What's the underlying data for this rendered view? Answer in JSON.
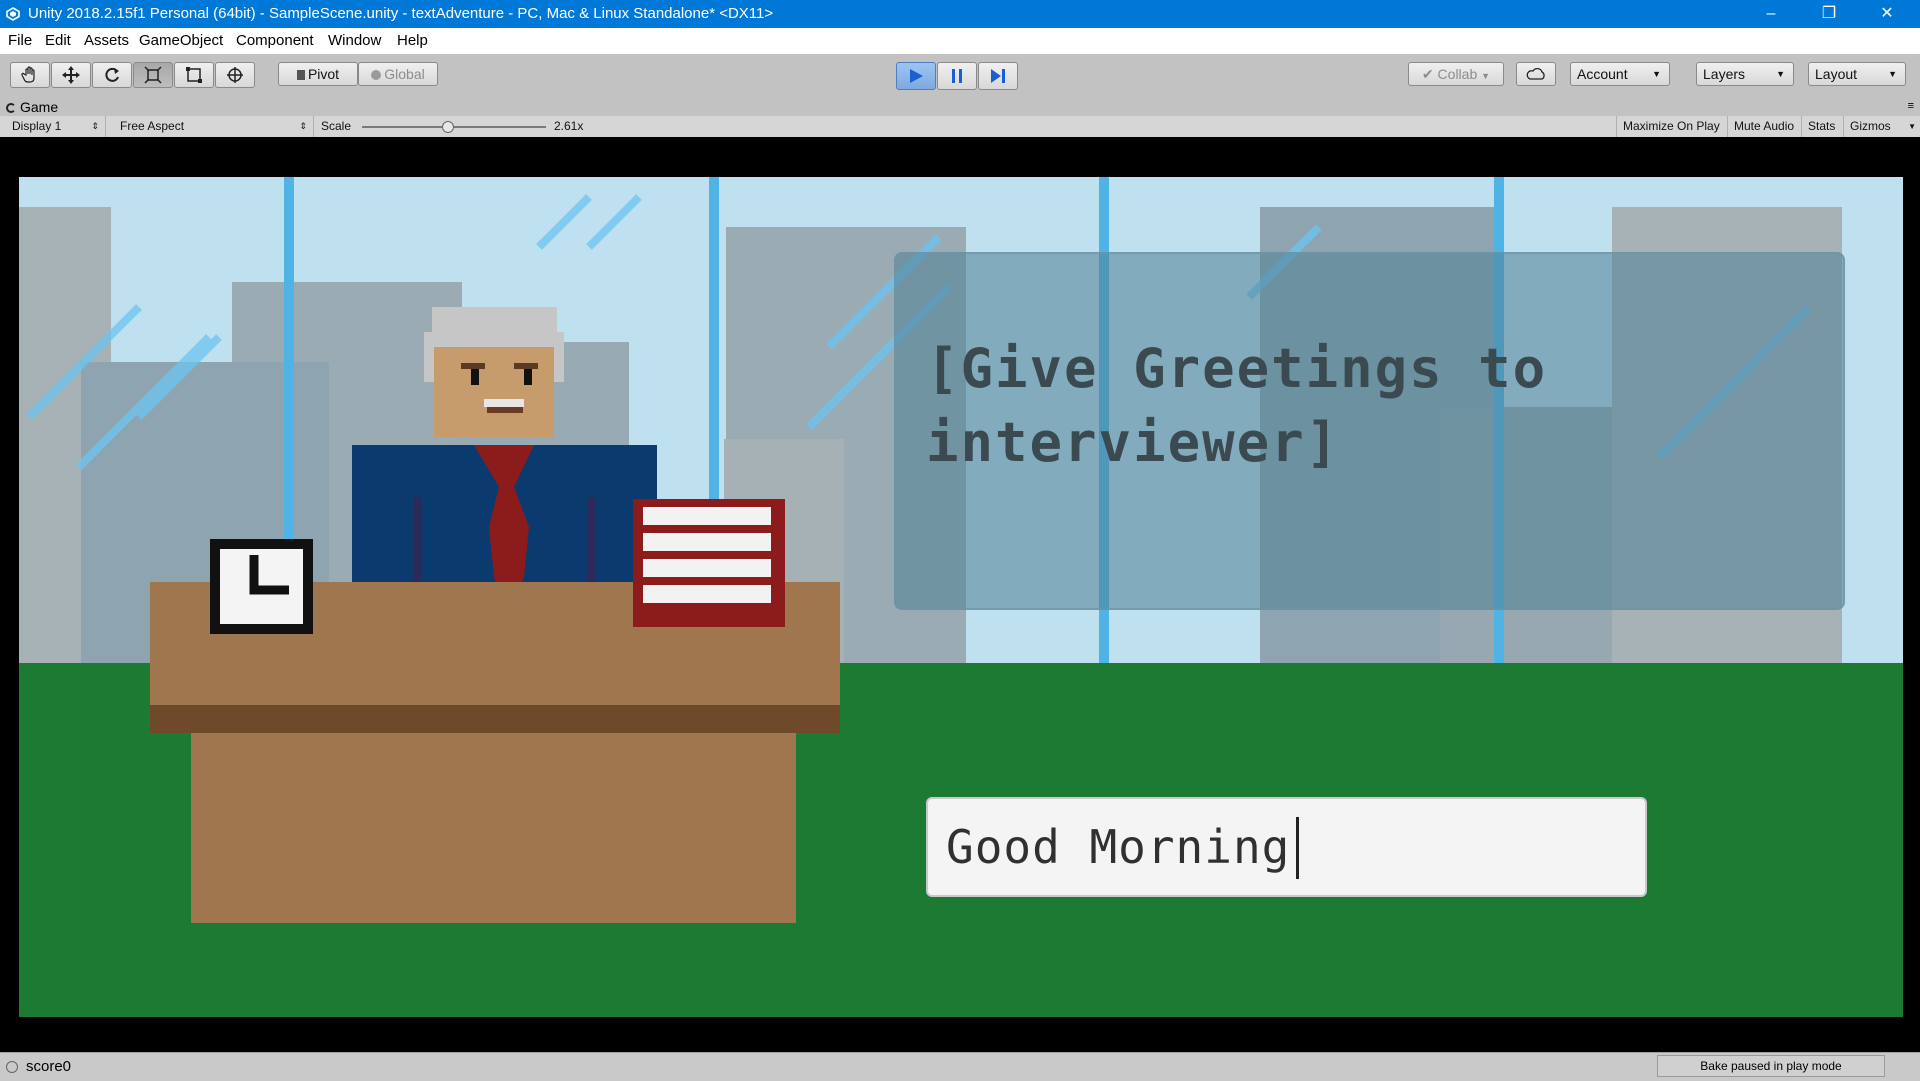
{
  "window": {
    "title": "Unity 2018.2.15f1 Personal (64bit) - SampleScene.unity - textAdventure - PC, Mac & Linux Standalone* <DX11>",
    "minimize": "–",
    "maximize": "❐",
    "close": "✕"
  },
  "menu": [
    "File",
    "Edit",
    "Assets",
    "GameObject",
    "Component",
    "Window",
    "Help"
  ],
  "toolbar": {
    "pivot": "Pivot",
    "global": "Global",
    "collab": "Collab",
    "account": "Account",
    "layers": "Layers",
    "layout": "Layout",
    "play_state": "playing"
  },
  "game_panel": {
    "tab": "Game",
    "display": "Display 1",
    "aspect": "Free Aspect",
    "scale_label": "Scale",
    "scale_value": "2.61x",
    "maximize_on_play": "Maximize On Play",
    "mute_audio": "Mute Audio",
    "stats": "Stats",
    "gizmos": "Gizmos"
  },
  "game": {
    "prompt": "[Give Greetings to interviewer]",
    "input_value": "Good Morning"
  },
  "status": {
    "score": "score0",
    "bake": "Bake paused in play mode"
  },
  "colors": {
    "titlebar": "#0078d7",
    "sky": "#bfe0ee",
    "ground": "#1d7a33",
    "desk": "#a0764e",
    "suit": "#0b3a6e",
    "tie": "#8c1c1c"
  }
}
